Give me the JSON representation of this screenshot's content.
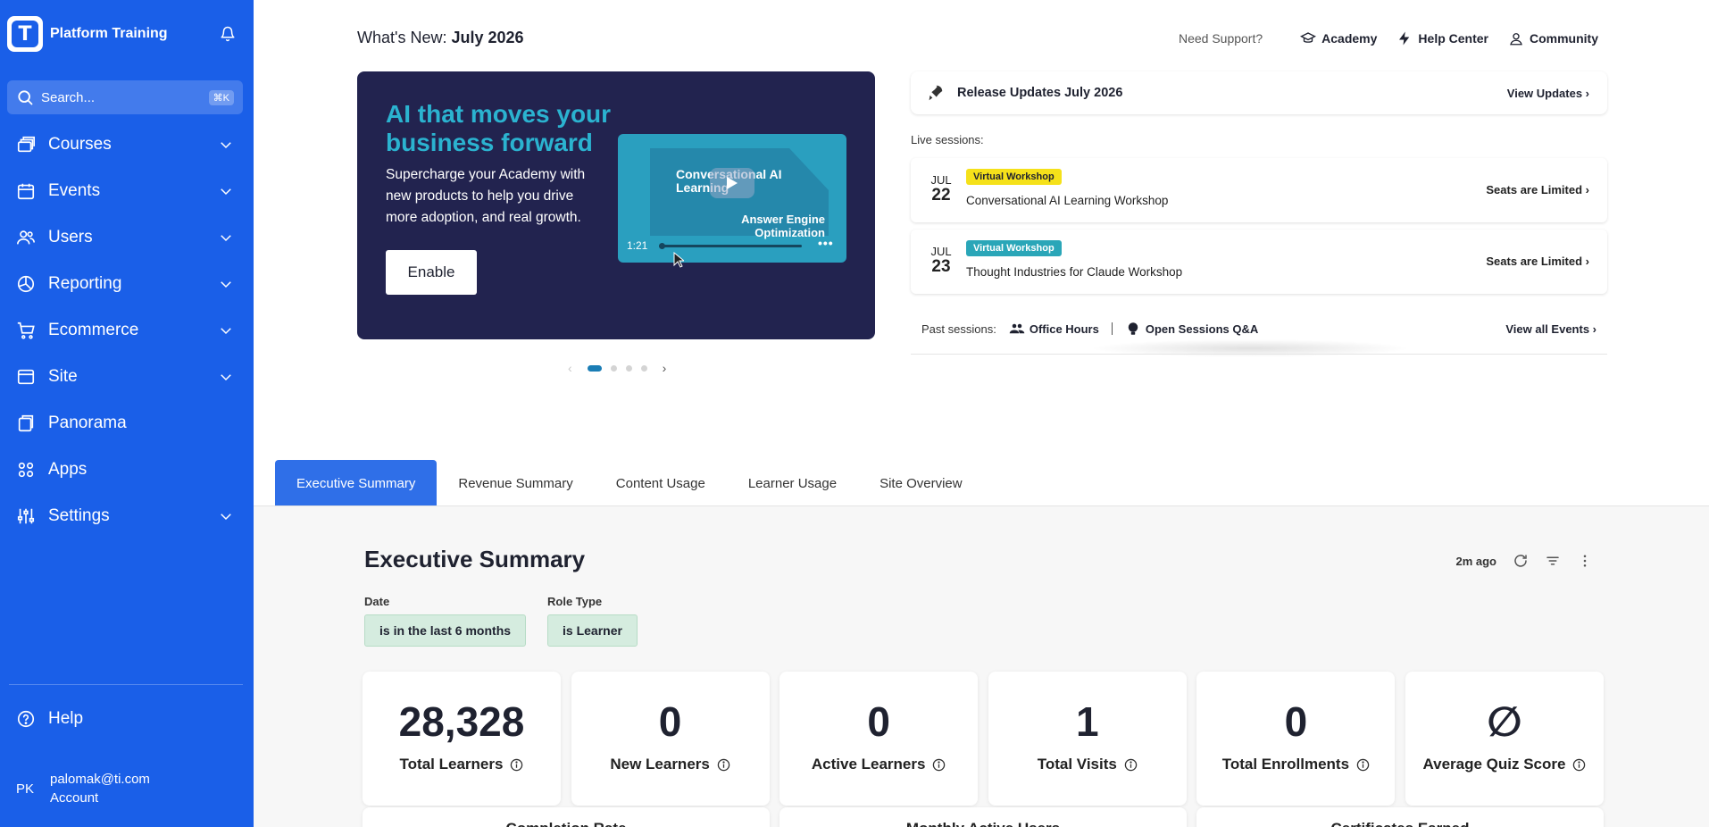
{
  "brand": {
    "name": "Platform Training",
    "logo_letter": "T"
  },
  "search": {
    "placeholder": "Search...",
    "shortcut": "⌘K"
  },
  "nav": [
    {
      "label": "Courses",
      "icon": "layers-icon",
      "expandable": true
    },
    {
      "label": "Events",
      "icon": "calendar-icon",
      "expandable": true
    },
    {
      "label": "Users",
      "icon": "users-icon",
      "expandable": true
    },
    {
      "label": "Reporting",
      "icon": "pie-chart-icon",
      "expandable": true
    },
    {
      "label": "Ecommerce",
      "icon": "cart-icon",
      "expandable": true
    },
    {
      "label": "Site",
      "icon": "browser-icon",
      "expandable": true
    },
    {
      "label": "Panorama",
      "icon": "panels-icon",
      "expandable": false
    },
    {
      "label": "Apps",
      "icon": "apps-icon",
      "expandable": false
    },
    {
      "label": "Settings",
      "icon": "sliders-icon",
      "expandable": true
    }
  ],
  "help": {
    "label": "Help"
  },
  "account": {
    "initials": "PK",
    "email": "palomak@ti.com",
    "label": "Account"
  },
  "header": {
    "whats_new_prefix": "What's New:",
    "whats_new_date": "July 2026",
    "support_label": "Need Support?",
    "links": [
      {
        "label": "Academy",
        "icon": "graduation-cap-icon"
      },
      {
        "label": "Help Center",
        "icon": "lightning-icon"
      },
      {
        "label": "Community",
        "icon": "community-icon"
      }
    ]
  },
  "hero": {
    "title": "AI that moves your business forward",
    "description": "Supercharge your Academy with new products to help you drive more adoption, and real growth.",
    "button": "Enable",
    "video": {
      "title_1": "Conversational AI Learning",
      "title_2": "Answer Engine Optimization",
      "time": "1:21"
    },
    "carousel": {
      "pages": 4,
      "active": 0
    }
  },
  "release": {
    "title": "Release Updates July 2026",
    "link": "View Updates ›"
  },
  "live_label": "Live sessions:",
  "sessions": [
    {
      "month": "JUL",
      "day": "22",
      "tag": "Virtual Workshop",
      "tag_color": "#f5e11a",
      "tag_text_color": "#1f2230",
      "name": "Conversational AI Learning Workshop",
      "cta": "Seats are Limited ›"
    },
    {
      "month": "JUL",
      "day": "23",
      "tag": "Virtual Workshop",
      "tag_color": "#2aa6b8",
      "tag_text_color": "#ffffff",
      "name": "Thought Industries for Claude Workshop",
      "cta": "Seats are Limited ›"
    }
  ],
  "past": {
    "label": "Past sessions:",
    "item1": "Office Hours",
    "item2": "Open Sessions Q&A",
    "link": "View all Events ›"
  },
  "tabs": [
    {
      "label": "Executive Summary",
      "active": true
    },
    {
      "label": "Revenue Summary",
      "active": false
    },
    {
      "label": "Content Usage",
      "active": false
    },
    {
      "label": "Learner Usage",
      "active": false
    },
    {
      "label": "Site Overview",
      "active": false
    }
  ],
  "summary": {
    "title": "Executive Summary",
    "updated": "2m ago",
    "filters": [
      {
        "label": "Date",
        "value": "is in the last 6 months"
      },
      {
        "label": "Role Type",
        "value": "is Learner"
      }
    ],
    "kpis": [
      {
        "value": "28,328",
        "label": "Total Learners"
      },
      {
        "value": "0",
        "label": "New Learners"
      },
      {
        "value": "0",
        "label": "Active Learners"
      },
      {
        "value": "1",
        "label": "Total Visits"
      },
      {
        "value": "0",
        "label": "Total Enrollments"
      },
      {
        "value": "∅",
        "label": "Average Quiz Score"
      }
    ],
    "next_cards": [
      "Completion Rate",
      "Monthly Active Users",
      "Certificates Earned"
    ]
  },
  "colors": {
    "sidebar": "#1a5fe8",
    "hero_bg": "#22234f",
    "hero_accent": "#2bb3d0",
    "tab_active": "#2f6fe8",
    "chip_bg": "#d5ecdf"
  }
}
